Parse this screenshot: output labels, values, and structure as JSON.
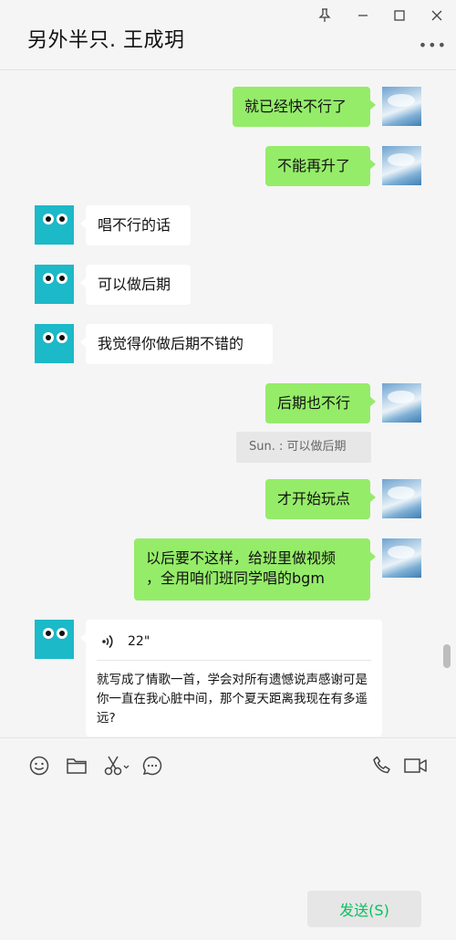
{
  "window": {
    "title": "另外半只. 王成玥",
    "controls": [
      "pin-icon",
      "minimize-icon",
      "maximize-icon",
      "close-icon"
    ],
    "more_label": "•••"
  },
  "messages": {
    "m1": "就已经快不行了",
    "m2": "不能再升了",
    "m3": "唱不行的话",
    "m4": "可以做后期",
    "m5": "我觉得你做后期不错的",
    "m6": "后期也不行",
    "quote": "Sun. : 可以做后期",
    "m7": "才开始玩点",
    "m8_line1": "以后要不这样，给班里做视频",
    "m8_line2": "，全用咱们班同学唱的bgm",
    "voice_duration": "22\"",
    "voice_transcript": "就写成了情歌一首，学会对所有遗憾说声感谢可是你一直在我心脏中间，那个夏天距离我现在有多遥远?"
  },
  "toolbar": {
    "left_icons": [
      "emoji-icon",
      "folder-icon",
      "scissors-icon",
      "chat-bubble-icon"
    ],
    "right_icons": [
      "phone-icon",
      "video-icon"
    ]
  },
  "send_button": "发送(S)",
  "colors": {
    "bubble_self": "#95ec69",
    "bubble_other": "#ffffff",
    "background": "#f5f5f5",
    "send_text": "#07c160",
    "bot_avatar": "#1cb9c8"
  }
}
